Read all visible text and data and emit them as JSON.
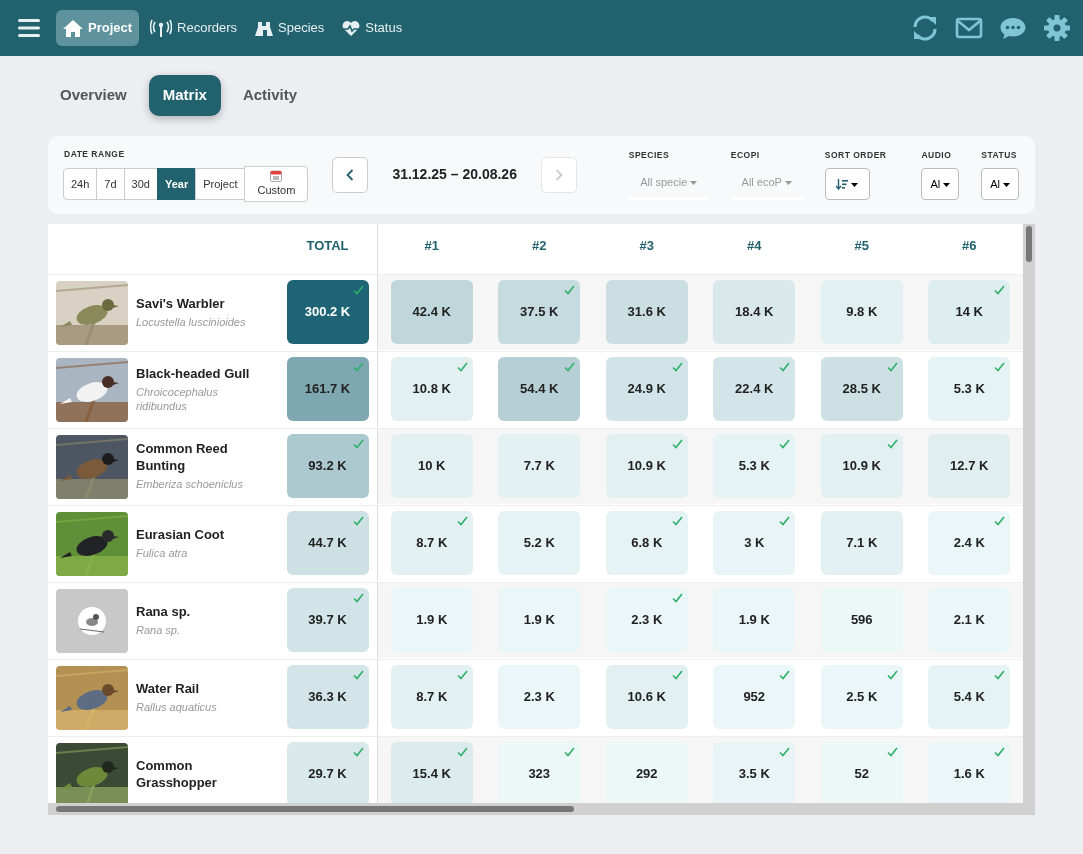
{
  "navbar": {
    "items": [
      {
        "label": "Project",
        "selected": true
      },
      {
        "label": "Recorders",
        "selected": false
      },
      {
        "label": "Species",
        "selected": false
      },
      {
        "label": "Status",
        "selected": false
      }
    ]
  },
  "tabs": [
    {
      "label": "Overview",
      "selected": false
    },
    {
      "label": "Matrix",
      "selected": true
    },
    {
      "label": "Activity",
      "selected": false
    }
  ],
  "filters": {
    "date_range": {
      "label": "DATE RANGE",
      "options": [
        {
          "label": "24h",
          "selected": false
        },
        {
          "label": "7d",
          "selected": false
        },
        {
          "label": "30d",
          "selected": false
        },
        {
          "label": "Year",
          "selected": true
        },
        {
          "label": "Project",
          "selected": false
        },
        {
          "label": "Custom",
          "selected": false
        }
      ]
    },
    "period": "31.12.25 – 20.08.26",
    "next_disabled": true,
    "species": {
      "label": "SPECIES",
      "value": "All specie"
    },
    "ecopi": {
      "label": "ECOPI",
      "value": "All ecoP"
    },
    "sort_order": {
      "label": "SORT ORDER"
    },
    "audio": {
      "label": "AUDIO",
      "value": "Al"
    },
    "status": {
      "label": "STATUS",
      "value": "Al"
    }
  },
  "table": {
    "columns": [
      "TOTAL",
      "#1",
      "#2",
      "#3",
      "#4",
      "#5",
      "#6"
    ],
    "rows": [
      {
        "name": "Savi's Warbler",
        "latin": "Locustella luscinioides",
        "photo": true,
        "cells": [
          {
            "value": "300.2 K",
            "color": "#1f6474",
            "verified": true
          },
          {
            "value": "42.4 K",
            "color": "#bfd7db",
            "verified": false
          },
          {
            "value": "37.5 K",
            "color": "#c5dbdf",
            "verified": true
          },
          {
            "value": "31.6 K",
            "color": "#cbdfe3",
            "verified": false
          },
          {
            "value": "18.4 K",
            "color": "#d8e8eb",
            "verified": false
          },
          {
            "value": "9.8 K",
            "color": "#e2f0f1",
            "verified": false
          },
          {
            "value": "14 K",
            "color": "#deedef",
            "verified": true
          }
        ]
      },
      {
        "name": "Black-headed Gull",
        "latin": "Chroicocephalus ridibundus",
        "photo": true,
        "cells": [
          {
            "value": "161.7 K",
            "color": "#7da8b1",
            "verified": true
          },
          {
            "value": "10.8 K",
            "color": "#e2f0f1",
            "verified": true
          },
          {
            "value": "54.4 K",
            "color": "#b5cfd4",
            "verified": true
          },
          {
            "value": "24.9 K",
            "color": "#d1e4e7",
            "verified": true
          },
          {
            "value": "22.4 K",
            "color": "#d3e5e8",
            "verified": true
          },
          {
            "value": "28.5 K",
            "color": "#cde1e4",
            "verified": true
          },
          {
            "value": "5.3 K",
            "color": "#e6f3f4",
            "verified": true
          }
        ]
      },
      {
        "name": "Common Reed Bunting",
        "latin": "Emberiza schoeniclus",
        "photo": true,
        "cells": [
          {
            "value": "93.2 K",
            "color": "#acc9cf",
            "verified": true
          },
          {
            "value": "10 K",
            "color": "#e2f0f1",
            "verified": false
          },
          {
            "value": "7.7 K",
            "color": "#e4f1f3",
            "verified": false
          },
          {
            "value": "10.9 K",
            "color": "#e2f0f1",
            "verified": true
          },
          {
            "value": "5.3 K",
            "color": "#e6f3f4",
            "verified": true
          },
          {
            "value": "10.9 K",
            "color": "#e2f0f1",
            "verified": true
          },
          {
            "value": "12.7 K",
            "color": "#e0eef0",
            "verified": false
          }
        ]
      },
      {
        "name": "Eurasian Coot",
        "latin": "Fulica atra",
        "photo": true,
        "cells": [
          {
            "value": "44.7 K",
            "color": "#cde1e4",
            "verified": true
          },
          {
            "value": "8.7 K",
            "color": "#e4f1f3",
            "verified": true
          },
          {
            "value": "5.2 K",
            "color": "#e6f3f4",
            "verified": false
          },
          {
            "value": "6.8 K",
            "color": "#e6f3f4",
            "verified": true
          },
          {
            "value": "3 K",
            "color": "#e8f4f5",
            "verified": true
          },
          {
            "value": "7.1 K",
            "color": "#e4f1f3",
            "verified": false
          },
          {
            "value": "2.4 K",
            "color": "#eaf6f7",
            "verified": true
          }
        ]
      },
      {
        "name": "Rana sp.",
        "latin": "Rana sp.",
        "photo": false,
        "cells": [
          {
            "value": "39.7 K",
            "color": "#d1e4e7",
            "verified": true
          },
          {
            "value": "1.9 K",
            "color": "#eaf6f7",
            "verified": false
          },
          {
            "value": "1.9 K",
            "color": "#eaf6f7",
            "verified": false
          },
          {
            "value": "2.3 K",
            "color": "#eaf6f7",
            "verified": true
          },
          {
            "value": "1.9 K",
            "color": "#eaf6f7",
            "verified": false
          },
          {
            "value": "596",
            "color": "#ecf7f8",
            "verified": false
          },
          {
            "value": "2.1 K",
            "color": "#eaf6f7",
            "verified": false
          }
        ]
      },
      {
        "name": "Water Rail",
        "latin": "Rallus aquaticus",
        "photo": true,
        "cells": [
          {
            "value": "36.3 K",
            "color": "#d3e5e8",
            "verified": true
          },
          {
            "value": "8.7 K",
            "color": "#e4f1f3",
            "verified": true
          },
          {
            "value": "2.3 K",
            "color": "#eaf6f7",
            "verified": false
          },
          {
            "value": "10.6 K",
            "color": "#e2f0f1",
            "verified": true
          },
          {
            "value": "952",
            "color": "#eaf6f7",
            "verified": true
          },
          {
            "value": "2.5 K",
            "color": "#eaf6f7",
            "verified": true
          },
          {
            "value": "5.4 K",
            "color": "#e6f3f4",
            "verified": true
          }
        ]
      },
      {
        "name": "Common Grasshopper",
        "photo": true,
        "cells": [
          {
            "value": "29.7 K",
            "color": "#d8e8eb",
            "verified": true
          },
          {
            "value": "15.4 K",
            "color": "#dcebed",
            "verified": true
          },
          {
            "value": "323",
            "color": "#ecf7f8",
            "verified": true
          },
          {
            "value": "292",
            "color": "#ecf7f8",
            "verified": false
          },
          {
            "value": "3.5 K",
            "color": "#e8f4f5",
            "verified": true
          },
          {
            "value": "52",
            "color": "#ecf7f8",
            "verified": true
          },
          {
            "value": "1.6 K",
            "color": "#eaf6f7",
            "verified": true
          }
        ]
      }
    ]
  }
}
